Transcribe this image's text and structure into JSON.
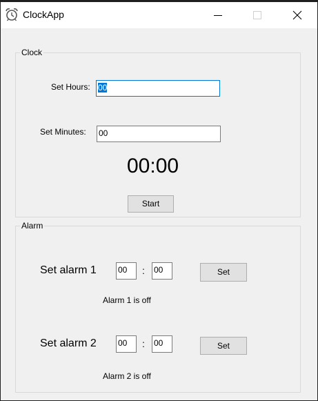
{
  "window": {
    "title": "ClockApp",
    "icon": "alarm-clock-icon",
    "controls": [
      "minimize-icon",
      "maximize-icon",
      "close-icon"
    ]
  },
  "clock": {
    "group_label": "Clock",
    "hours_label": "Set Hours:",
    "hours_value": "00",
    "minutes_label": "Set Minutes:",
    "minutes_value": "00",
    "display": "00:00",
    "start_label": "Start"
  },
  "alarm": {
    "group_label": "Alarm",
    "alarms": [
      {
        "title": "Set alarm 1",
        "hours": "00",
        "separator": ":",
        "minutes": "00",
        "set_label": "Set",
        "status": "Alarm 1 is off"
      },
      {
        "title": "Set alarm 2",
        "hours": "00",
        "separator": ":",
        "minutes": "00",
        "set_label": "Set",
        "status": "Alarm 2 is off"
      }
    ]
  },
  "colors": {
    "titlebar_bg": "#ffffff",
    "window_bg": "#f0f0f0",
    "focus_border": "#0078d7",
    "selection": "#0078d7",
    "button_bg": "#e1e1e1"
  }
}
